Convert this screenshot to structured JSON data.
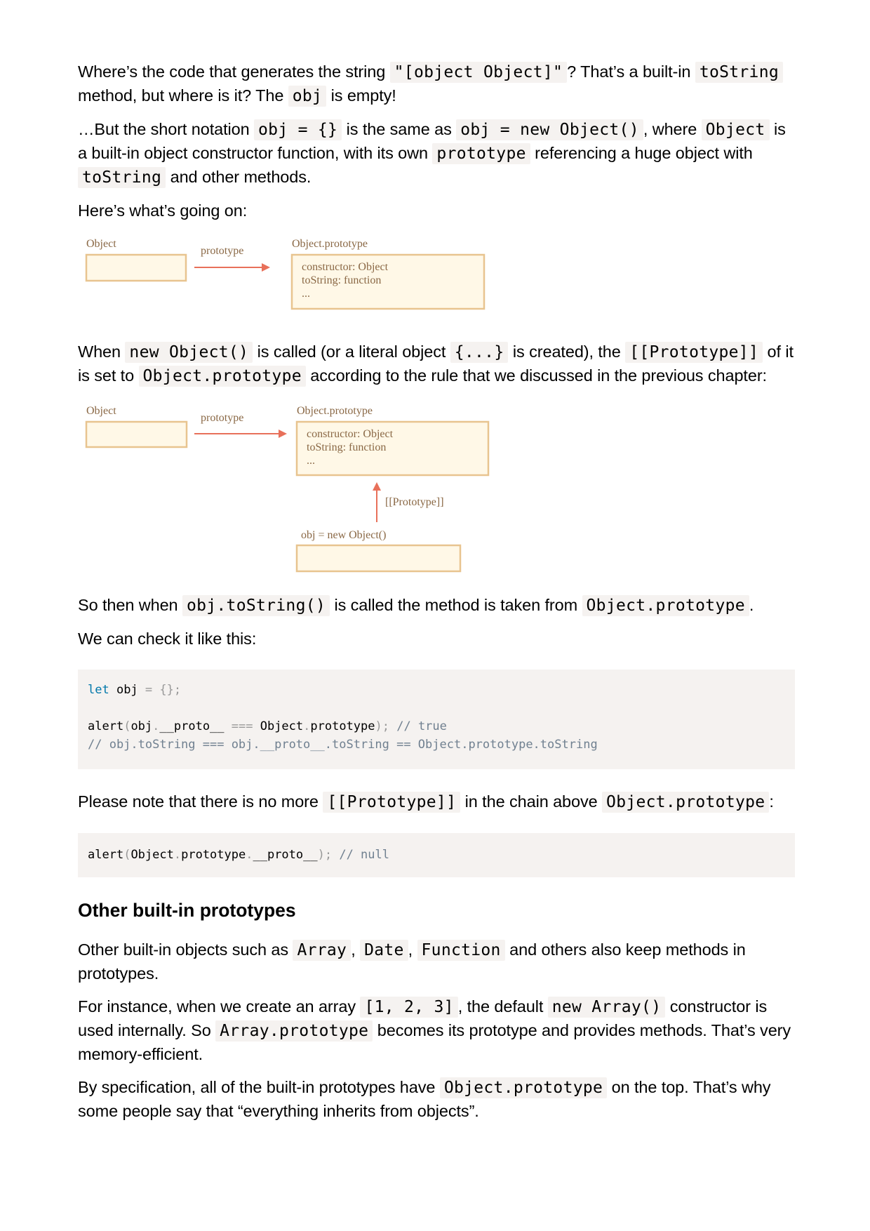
{
  "intro": {
    "p1": {
      "t1": "Where’s the code that generates the string ",
      "c1": "\"[object Object]\"",
      "t2": "? That’s a built-in ",
      "c2": "toString",
      "t3": " method, but where is it? The ",
      "c3": "obj",
      "t4": " is empty!"
    },
    "p2": {
      "t1": "…But the short notation ",
      "c1": "obj = {}",
      "t2": " is the same as ",
      "c2": "obj = new Object()",
      "t3": ", where ",
      "c3": "Object",
      "t4": " is a built-in object constructor function, with its own ",
      "c4": "prototype",
      "t5": " referencing a huge object with ",
      "c5": "toString",
      "t6": " and other methods."
    },
    "p3": "Here’s what’s going on:"
  },
  "diagram1": {
    "object_label": "Object",
    "arrow_label": "prototype",
    "proto_label": "Object.prototype",
    "proto_lines": [
      "constructor: Object",
      "toString: function",
      "..."
    ]
  },
  "middle": {
    "p1": {
      "t1": "When ",
      "c1": "new Object()",
      "t2": " is called (or a literal object ",
      "c2": "{...}",
      "t3": " is created), the ",
      "c3": "[[Prototype]]",
      "t4": " of it is set to ",
      "c4": "Object.prototype",
      "t5": " according to the rule that we discussed in the previous chapter:"
    }
  },
  "diagram2": {
    "object_label": "Object",
    "arrow_label": "prototype",
    "proto_label": "Object.prototype",
    "proto_lines": [
      "constructor: Object",
      "toString: function",
      "..."
    ],
    "link_label": "[[Prototype]]",
    "obj_label": "obj = new Object()"
  },
  "after": {
    "p1": {
      "t1": "So then when ",
      "c1": "obj.toString()",
      "t2": " is called the method is taken from ",
      "c2": "Object.prototype",
      "t3": "."
    },
    "p2": "We can check it like this:"
  },
  "code1": {
    "l1_kw": "let",
    "l1_a": " obj ",
    "l1_b": "=",
    "l1_c": " {};",
    "l3_a": "alert",
    "l3_b": "(",
    "l3_c": "obj",
    "l3_d": ".",
    "l3_e": "__proto__ ",
    "l3_f": "===",
    "l3_g": " Object",
    "l3_h": ".",
    "l3_i": "prototype",
    "l3_j": ");",
    "l3_k": " // true",
    "l4": "// obj.toString === obj.__proto__.toString == Object.prototype.toString"
  },
  "note": {
    "t1": "Please note that there is no more ",
    "c1": "[[Prototype]]",
    "t2": " in the chain above ",
    "c2": "Object.prototype",
    "t3": ":"
  },
  "code2": {
    "a": "alert",
    "b": "(",
    "c": "Object",
    "d": ".",
    "e": "prototype",
    "f": ".",
    "g": "__proto__",
    "h": ");",
    "i": " // null"
  },
  "section": {
    "heading": "Other built-in prototypes",
    "p1": {
      "t1": "Other built-in objects such as ",
      "c1": "Array",
      "t2": ", ",
      "c2": "Date",
      "t3": ", ",
      "c3": "Function",
      "t4": " and others also keep methods in prototypes."
    },
    "p2": {
      "t1": "For instance, when we create an array ",
      "c1": "[1, 2, 3]",
      "t2": ", the default ",
      "c2": "new Array()",
      "t3": " constructor is used internally. So ",
      "c3": "Array.prototype",
      "t4": " becomes its prototype and provides methods. That’s very memory-efficient."
    },
    "p3": {
      "t1": "By specification, all of the built-in prototypes have ",
      "c1": "Object.prototype",
      "t2": " on the top. That’s why some people say that “everything inherits from objects”."
    }
  },
  "colors": {
    "box_fill": "#fff8e7",
    "box_stroke": "#e8c48f",
    "arrow": "#e8705a",
    "diagram_text": "#8a6845",
    "code_bg": "#f5f2f0",
    "keyword": "#0077aa",
    "comment": "#708090"
  }
}
